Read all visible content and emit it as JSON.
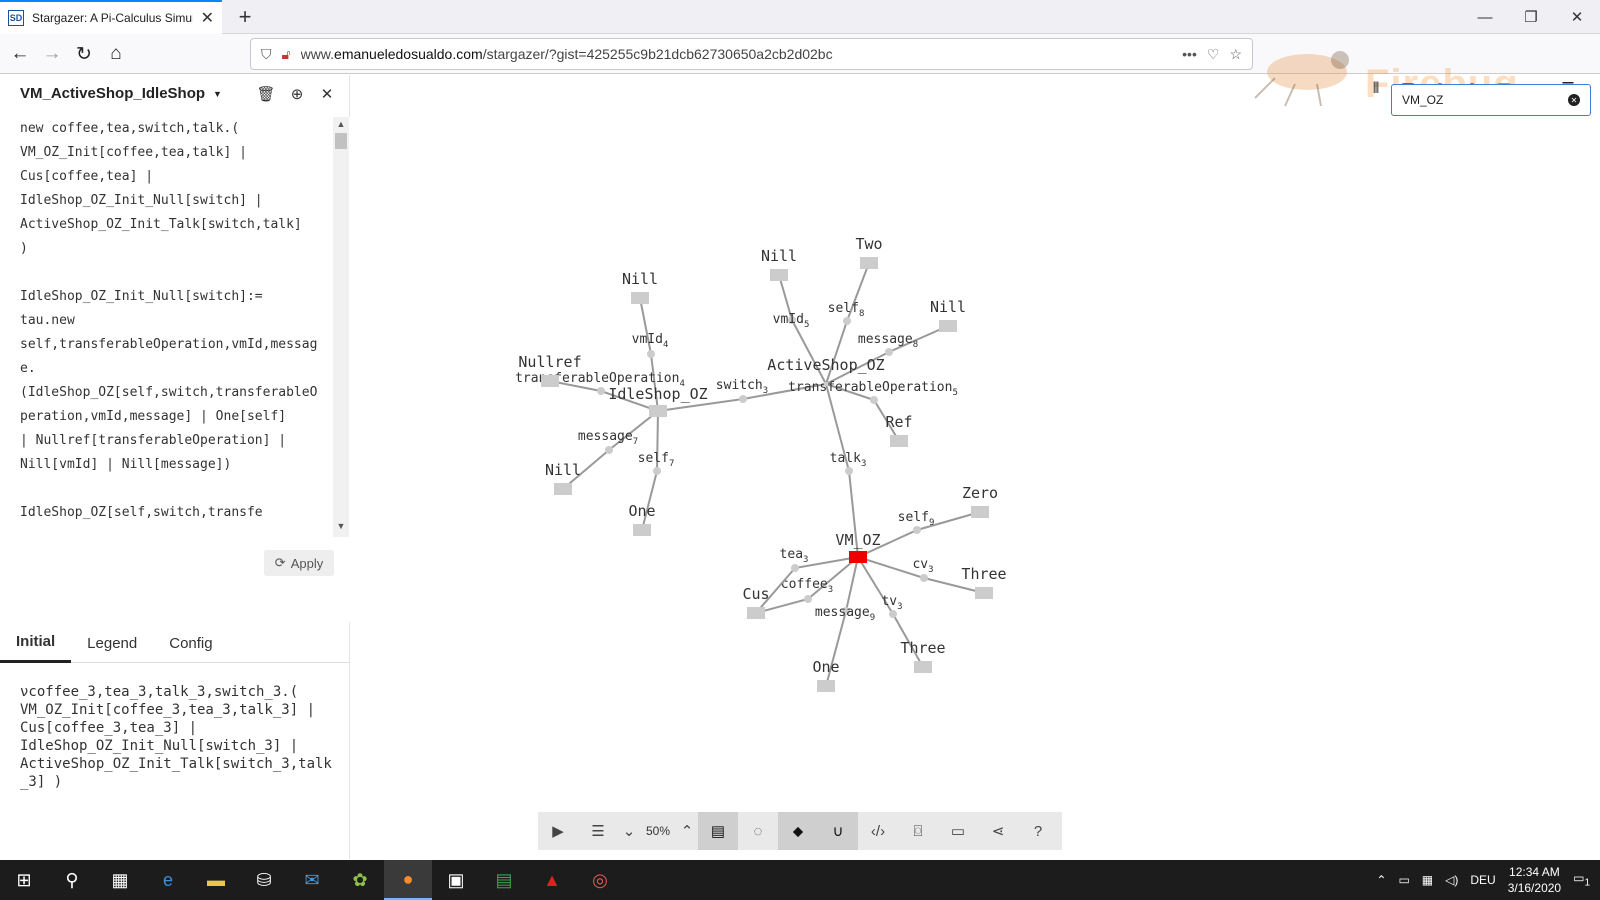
{
  "browser": {
    "tab_favicon": "SD",
    "tab_title": "Stargazer: A Pi-Calculus Simula",
    "url_prefix": "www.",
    "url_domain": "emanueledosualdo.com",
    "url_path": "/stargazer/?gist=425255c9b21dcb62730650a2cb2d02bc",
    "firebug_watermark": "Firebug"
  },
  "left": {
    "program_name": "VM_ActiveShop_IdleShop",
    "code": "new coffee,tea,switch,talk.(\nVM_OZ_Init[coffee,tea,talk] |\nCus[coffee,tea] |\nIdleShop_OZ_Init_Null[switch] |\nActiveShop_OZ_Init_Talk[switch,talk]\n)\n\nIdleShop_OZ_Init_Null[switch]:=\ntau.new\nself,transferableOperation,vmId,message.\n(IdleShop_OZ[self,switch,transferableOperation,vmId,message] | One[self]\n| Nullref[transferableOperation] |\nNill[vmId] | Nill[message])\n\nIdleShop_OZ[self,switch,transfe",
    "apply_label": "Apply",
    "tabs": [
      "Initial",
      "Legend",
      "Config"
    ],
    "initial_text": "νcoffee_3,tea_3,talk_3,switch_3.(\nVM_OZ_Init[coffee_3,tea_3,talk_3] |\nCus[coffee_3,tea_3] |\nIdleShop_OZ_Init_Null[switch_3] |\nActiveShop_OZ_Init_Talk[switch_3,talk_3] )"
  },
  "search": {
    "value": "VM_OZ"
  },
  "toolbar": {
    "zoom": "50%"
  },
  "graph": {
    "nodes": [
      {
        "label": "VM_OZ",
        "highlight": true
      },
      {
        "label": "IdleShop_OZ"
      },
      {
        "label": "ActiveShop_OZ"
      },
      {
        "label": "Nill"
      },
      {
        "label": "Nullref"
      },
      {
        "label": "Nill"
      },
      {
        "label": "One"
      },
      {
        "label": "Nill"
      },
      {
        "label": "Two"
      },
      {
        "label": "Nill"
      },
      {
        "label": "Ref"
      },
      {
        "label": "Zero"
      },
      {
        "label": "Three"
      },
      {
        "label": "Three"
      },
      {
        "label": "One"
      },
      {
        "label": "Cus"
      }
    ],
    "edges": [
      {
        "label": "vmId",
        "sub": "4"
      },
      {
        "label": "transferableOperation",
        "sub": "4"
      },
      {
        "label": "message",
        "sub": "7"
      },
      {
        "label": "self",
        "sub": "7"
      },
      {
        "label": "switch",
        "sub": "3"
      },
      {
        "label": "vmId",
        "sub": "5"
      },
      {
        "label": "self",
        "sub": "8"
      },
      {
        "label": "message",
        "sub": "8"
      },
      {
        "label": "transferableOperation",
        "sub": "5"
      },
      {
        "label": "talk",
        "sub": "3"
      },
      {
        "label": "self",
        "sub": "9"
      },
      {
        "label": "cv",
        "sub": "3"
      },
      {
        "label": "tv",
        "sub": "3"
      },
      {
        "label": "message",
        "sub": "9"
      },
      {
        "label": "coffee",
        "sub": "3"
      },
      {
        "label": "tea",
        "sub": "3"
      },
      {
        "label": "tea",
        "sub": "3"
      }
    ]
  },
  "taskbar": {
    "language": "DEU",
    "time": "12:34 AM",
    "date": "3/16/2020",
    "notifications": "1"
  }
}
